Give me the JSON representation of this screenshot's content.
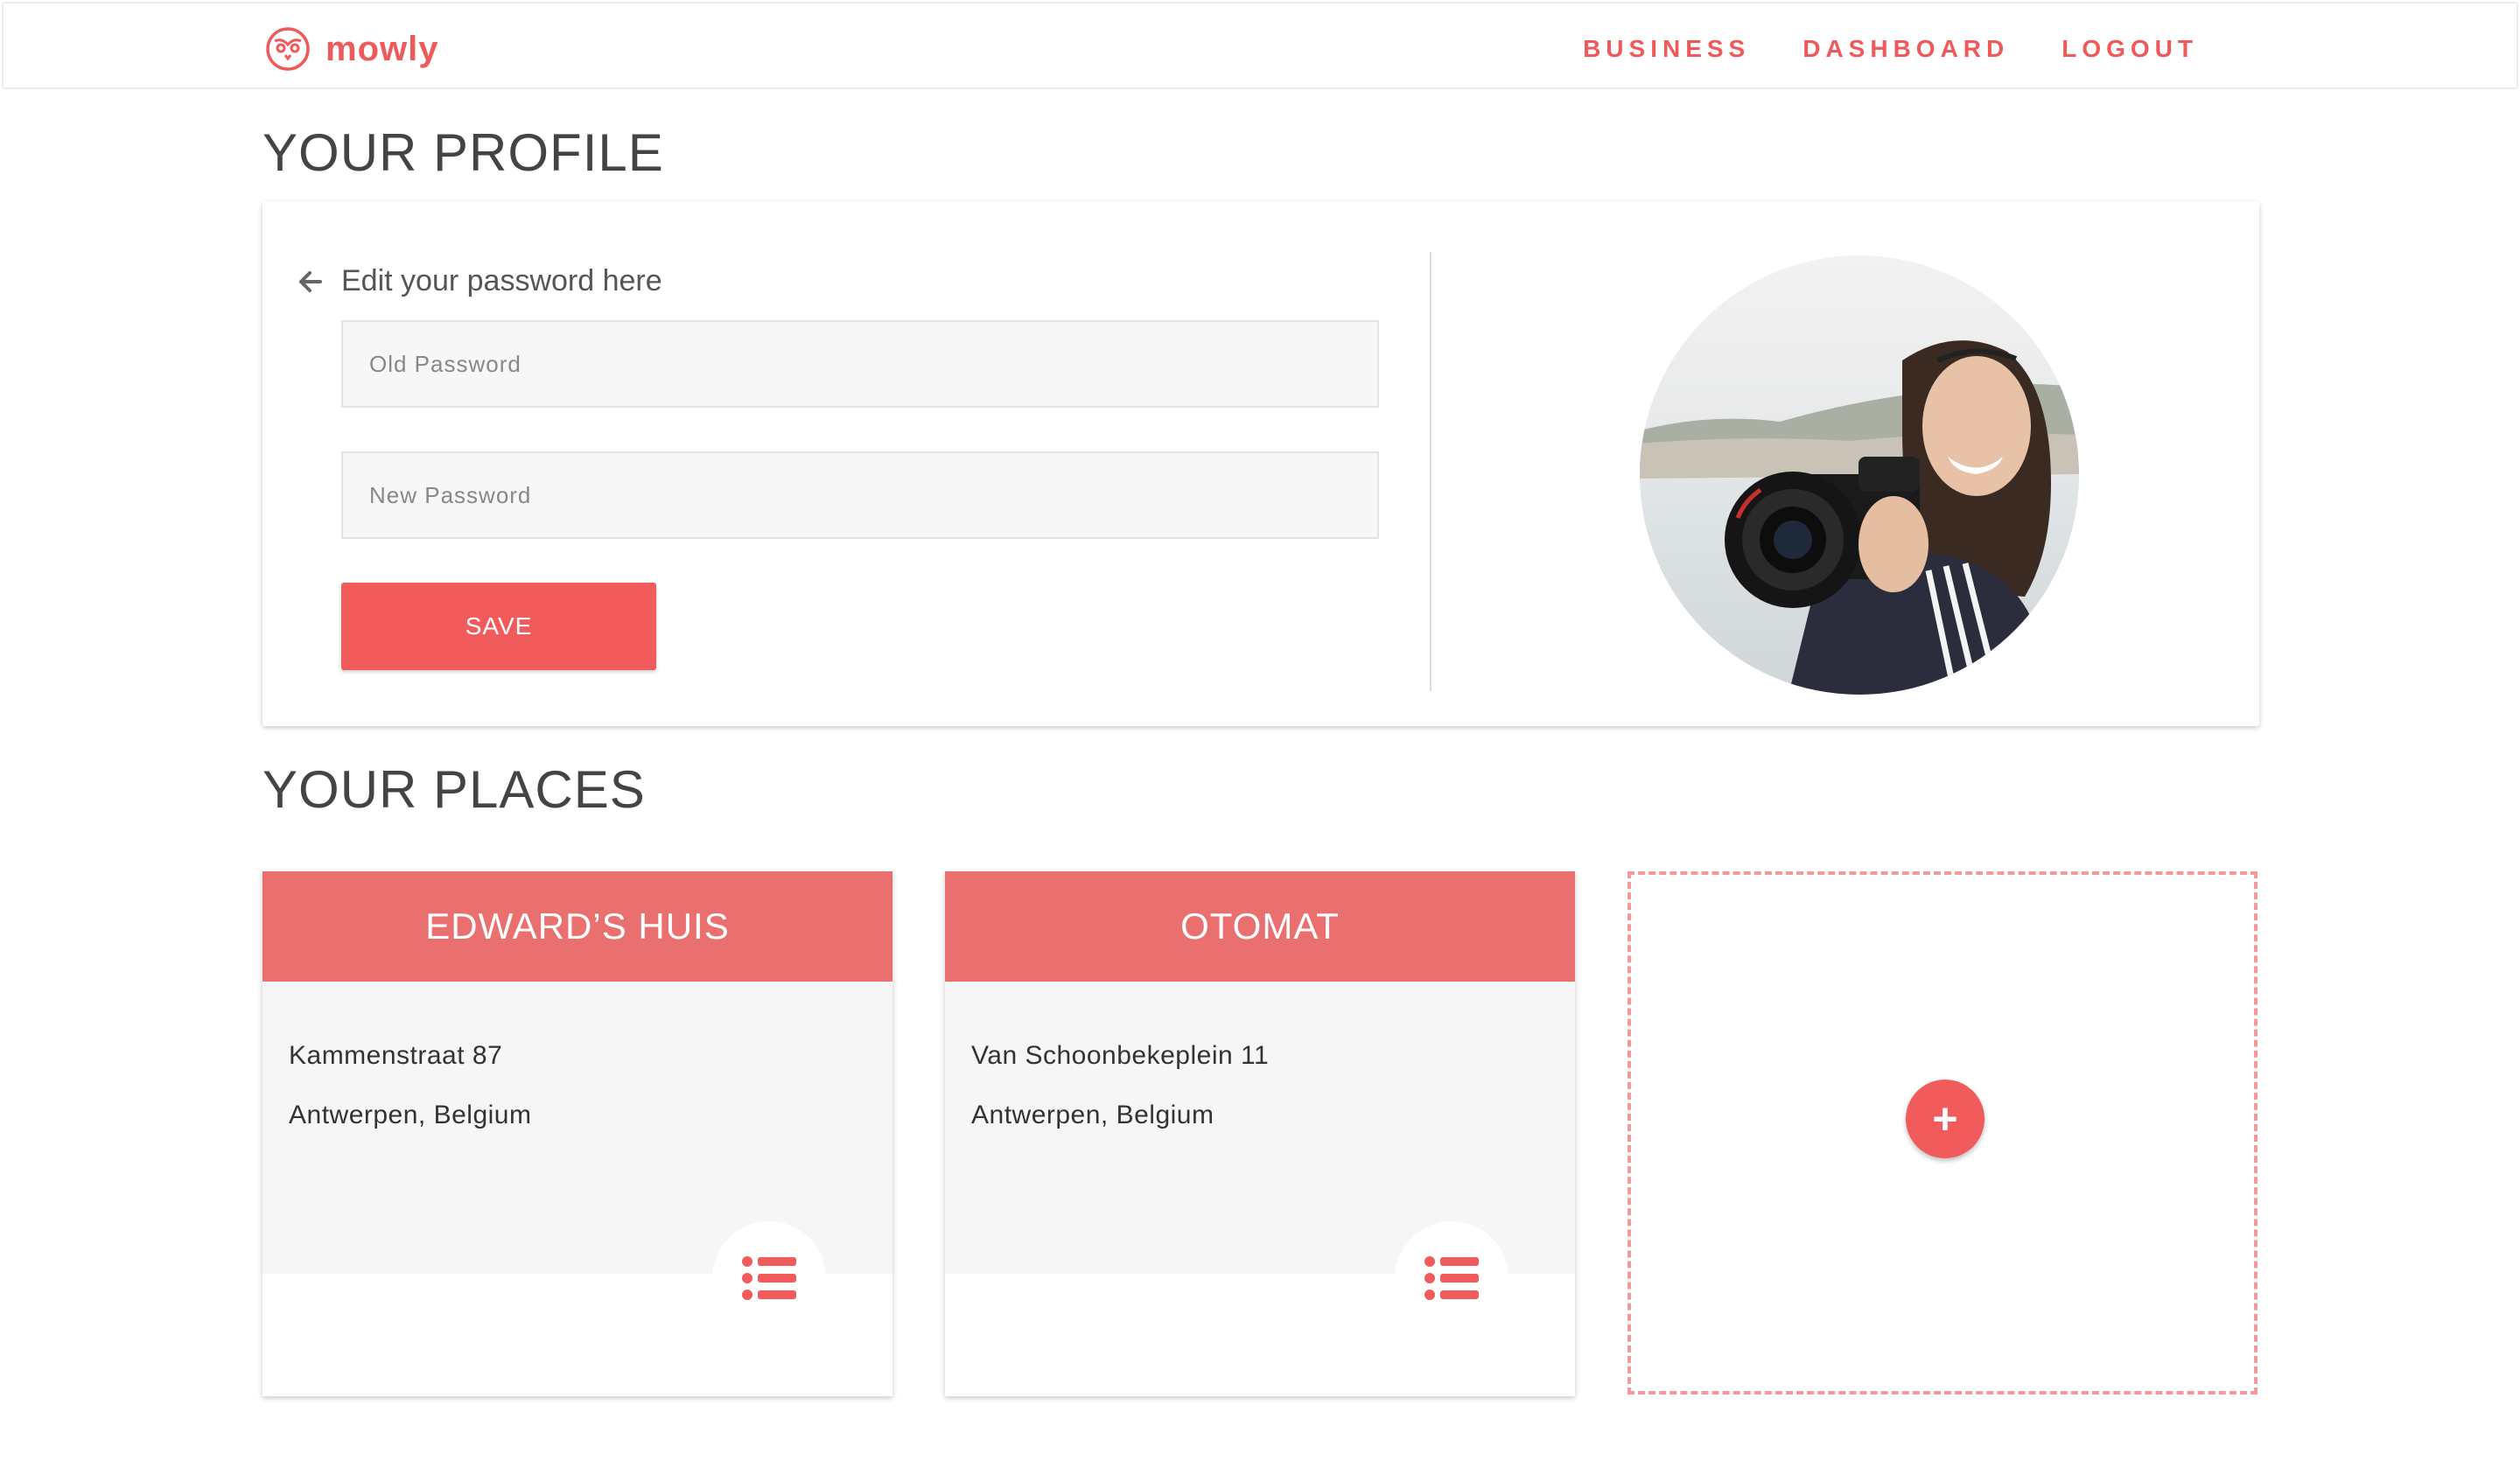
{
  "brand": {
    "name": "mowly",
    "icon": "owl-icon"
  },
  "nav": {
    "items": [
      "BUSINESS",
      "DASHBOARD",
      "LOGOUT"
    ]
  },
  "profile": {
    "title": "YOUR PROFILE",
    "edit_label": "Edit your password here",
    "old_password_placeholder": "Old Password",
    "new_password_placeholder": "New Password",
    "save_label": "SAVE"
  },
  "places": {
    "title": "YOUR PLACES",
    "items": [
      {
        "name": "EDWARD’S HUIS",
        "street": "Kammenstraat 87",
        "city": "Antwerpen, Belgium"
      },
      {
        "name": "OTOMAT",
        "street": "Van Schoonbekeplein 11",
        "city": "Antwerpen, Belgium"
      }
    ],
    "add_label": "+"
  },
  "colors": {
    "accent": "#f25b5b",
    "header": "#ea6f6f",
    "dashed": "#f19a9a"
  }
}
